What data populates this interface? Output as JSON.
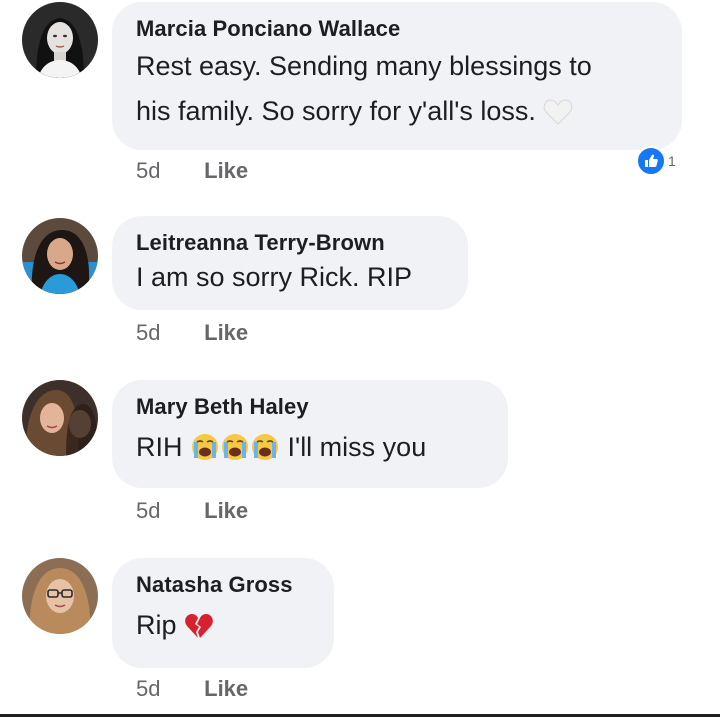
{
  "comments": [
    {
      "author": "Marcia Ponciano Wallace",
      "text_lines": [
        "Rest easy. Sending many blessings to",
        "his family. So sorry for y'all's loss."
      ],
      "emoji": "white-heart",
      "age": "5d",
      "like_label": "Like",
      "reaction_count": "1",
      "reaction_icon": "like-reaction-icon"
    },
    {
      "author": "Leitreanna Terry-Brown",
      "text": "I am so sorry Rick. RIP",
      "age": "5d",
      "like_label": "Like"
    },
    {
      "author": "Mary Beth Haley",
      "text_before": "RIH",
      "emojis": [
        "loudly-crying-face",
        "loudly-crying-face",
        "loudly-crying-face"
      ],
      "text_after": "I'll miss you",
      "age": "5d",
      "like_label": "Like"
    },
    {
      "author": "Natasha Gross",
      "text": "Rip",
      "emoji": "broken-heart",
      "age": "5d",
      "like_label": "Like"
    }
  ],
  "colors": {
    "bubble": "#f0f2f5",
    "meta": "#65676b",
    "like_blue": "#1877f2"
  }
}
